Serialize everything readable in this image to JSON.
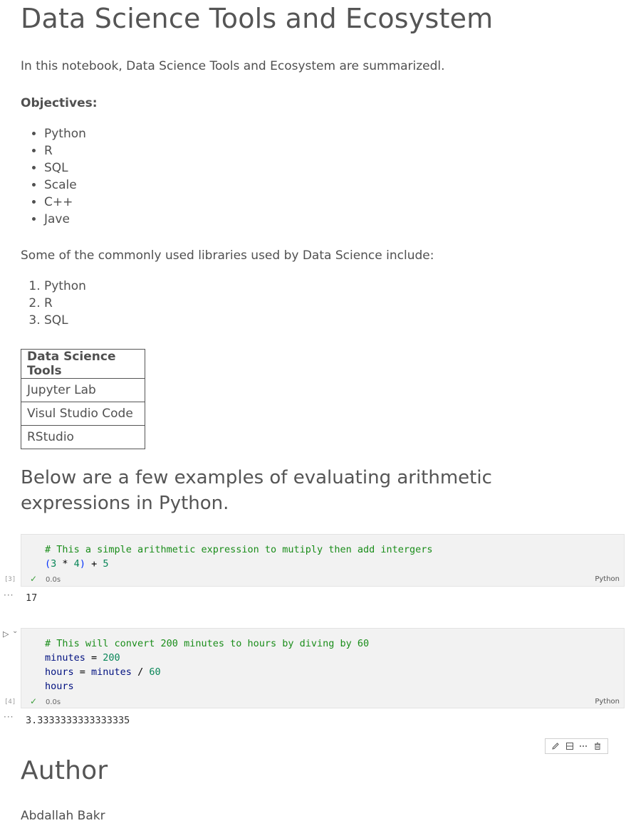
{
  "notebook": {
    "title": "Data Science Tools and Ecosystem",
    "intro": "In this notebook, Data Science Tools and Ecosystem are summarizedl.",
    "objectives_label": "Objectives:",
    "objectives": [
      "Python",
      "R",
      "SQL",
      "Scale",
      "C++",
      "Jave"
    ],
    "libraries_intro": "Some of the commonly used libraries used by Data Science include:",
    "libraries": [
      "Python",
      "R",
      "SQL"
    ],
    "tools_table": {
      "header": "Data Science Tools",
      "rows": [
        "Jupyter Lab",
        "Visul Studio Code",
        "RStudio"
      ]
    },
    "examples_heading": "Below are a few examples of evaluating arithmetic expressions in Python.",
    "author_heading": "Author",
    "author_name": "Abdallah Bakr"
  },
  "cells": [
    {
      "exec_count": "[3]",
      "comment": "# This a simple arithmetic expression to mutiply then add intergers",
      "time": "0.0s",
      "language": "Python",
      "output": "17"
    },
    {
      "exec_count": "[4]",
      "comment": "# This will convert 200 minutes to hours by diving by 60",
      "time": "0.0s",
      "language": "Python",
      "output": "3.3333333333333335"
    }
  ],
  "icons": {
    "check": "✓",
    "more": "···",
    "run": "▷",
    "chevron": "⌄"
  }
}
